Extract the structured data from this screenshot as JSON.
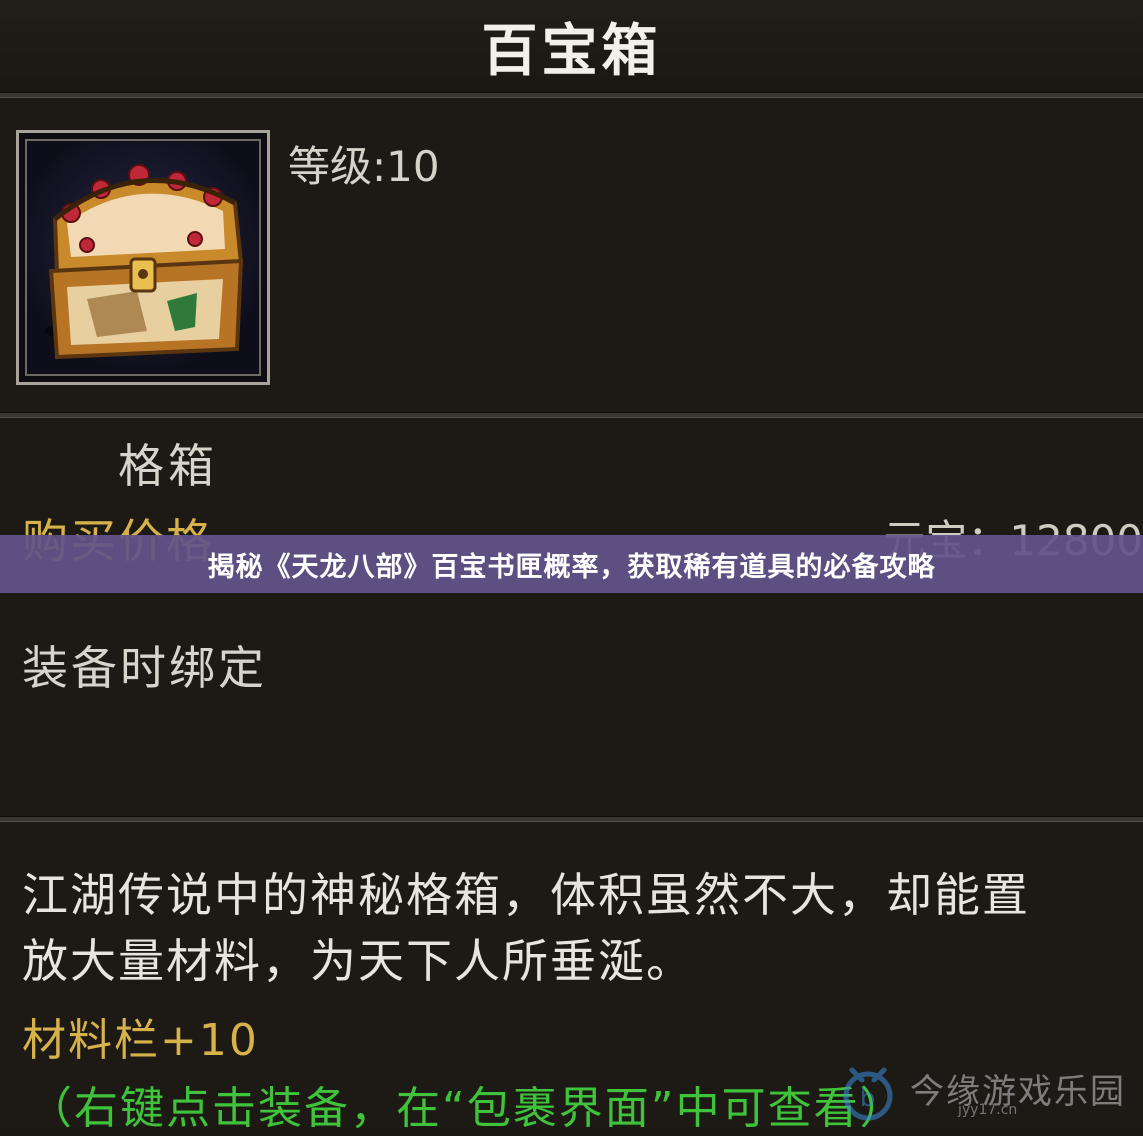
{
  "window": {
    "title": "百宝箱"
  },
  "item": {
    "level_text": "等级:10",
    "name": "格箱",
    "price_label": "购买价格",
    "price_value": "元宝：12800",
    "bind_text": "装备时绑定",
    "description_line1": "江湖传说中的神秘格箱，体积虽然不大，却能置",
    "description_line2": "放大量材料，为天下人所垂涎。",
    "slots_text": "材料栏+10",
    "usage_hint": "（右键点击装备，在“包裹界面”中可查看）",
    "icon": "treasure-chest-icon"
  },
  "banner": {
    "text": "揭秘《天龙八部》百宝书匣概率，获取稀有道具的必备攻略"
  },
  "watermark": {
    "text": "今缘游戏乐园",
    "url": "jyy17.cn"
  },
  "colors": {
    "background": "#1d1a15",
    "gold_text": "#d7b24a",
    "green_text": "#3fc33b",
    "banner": "#62548a"
  }
}
